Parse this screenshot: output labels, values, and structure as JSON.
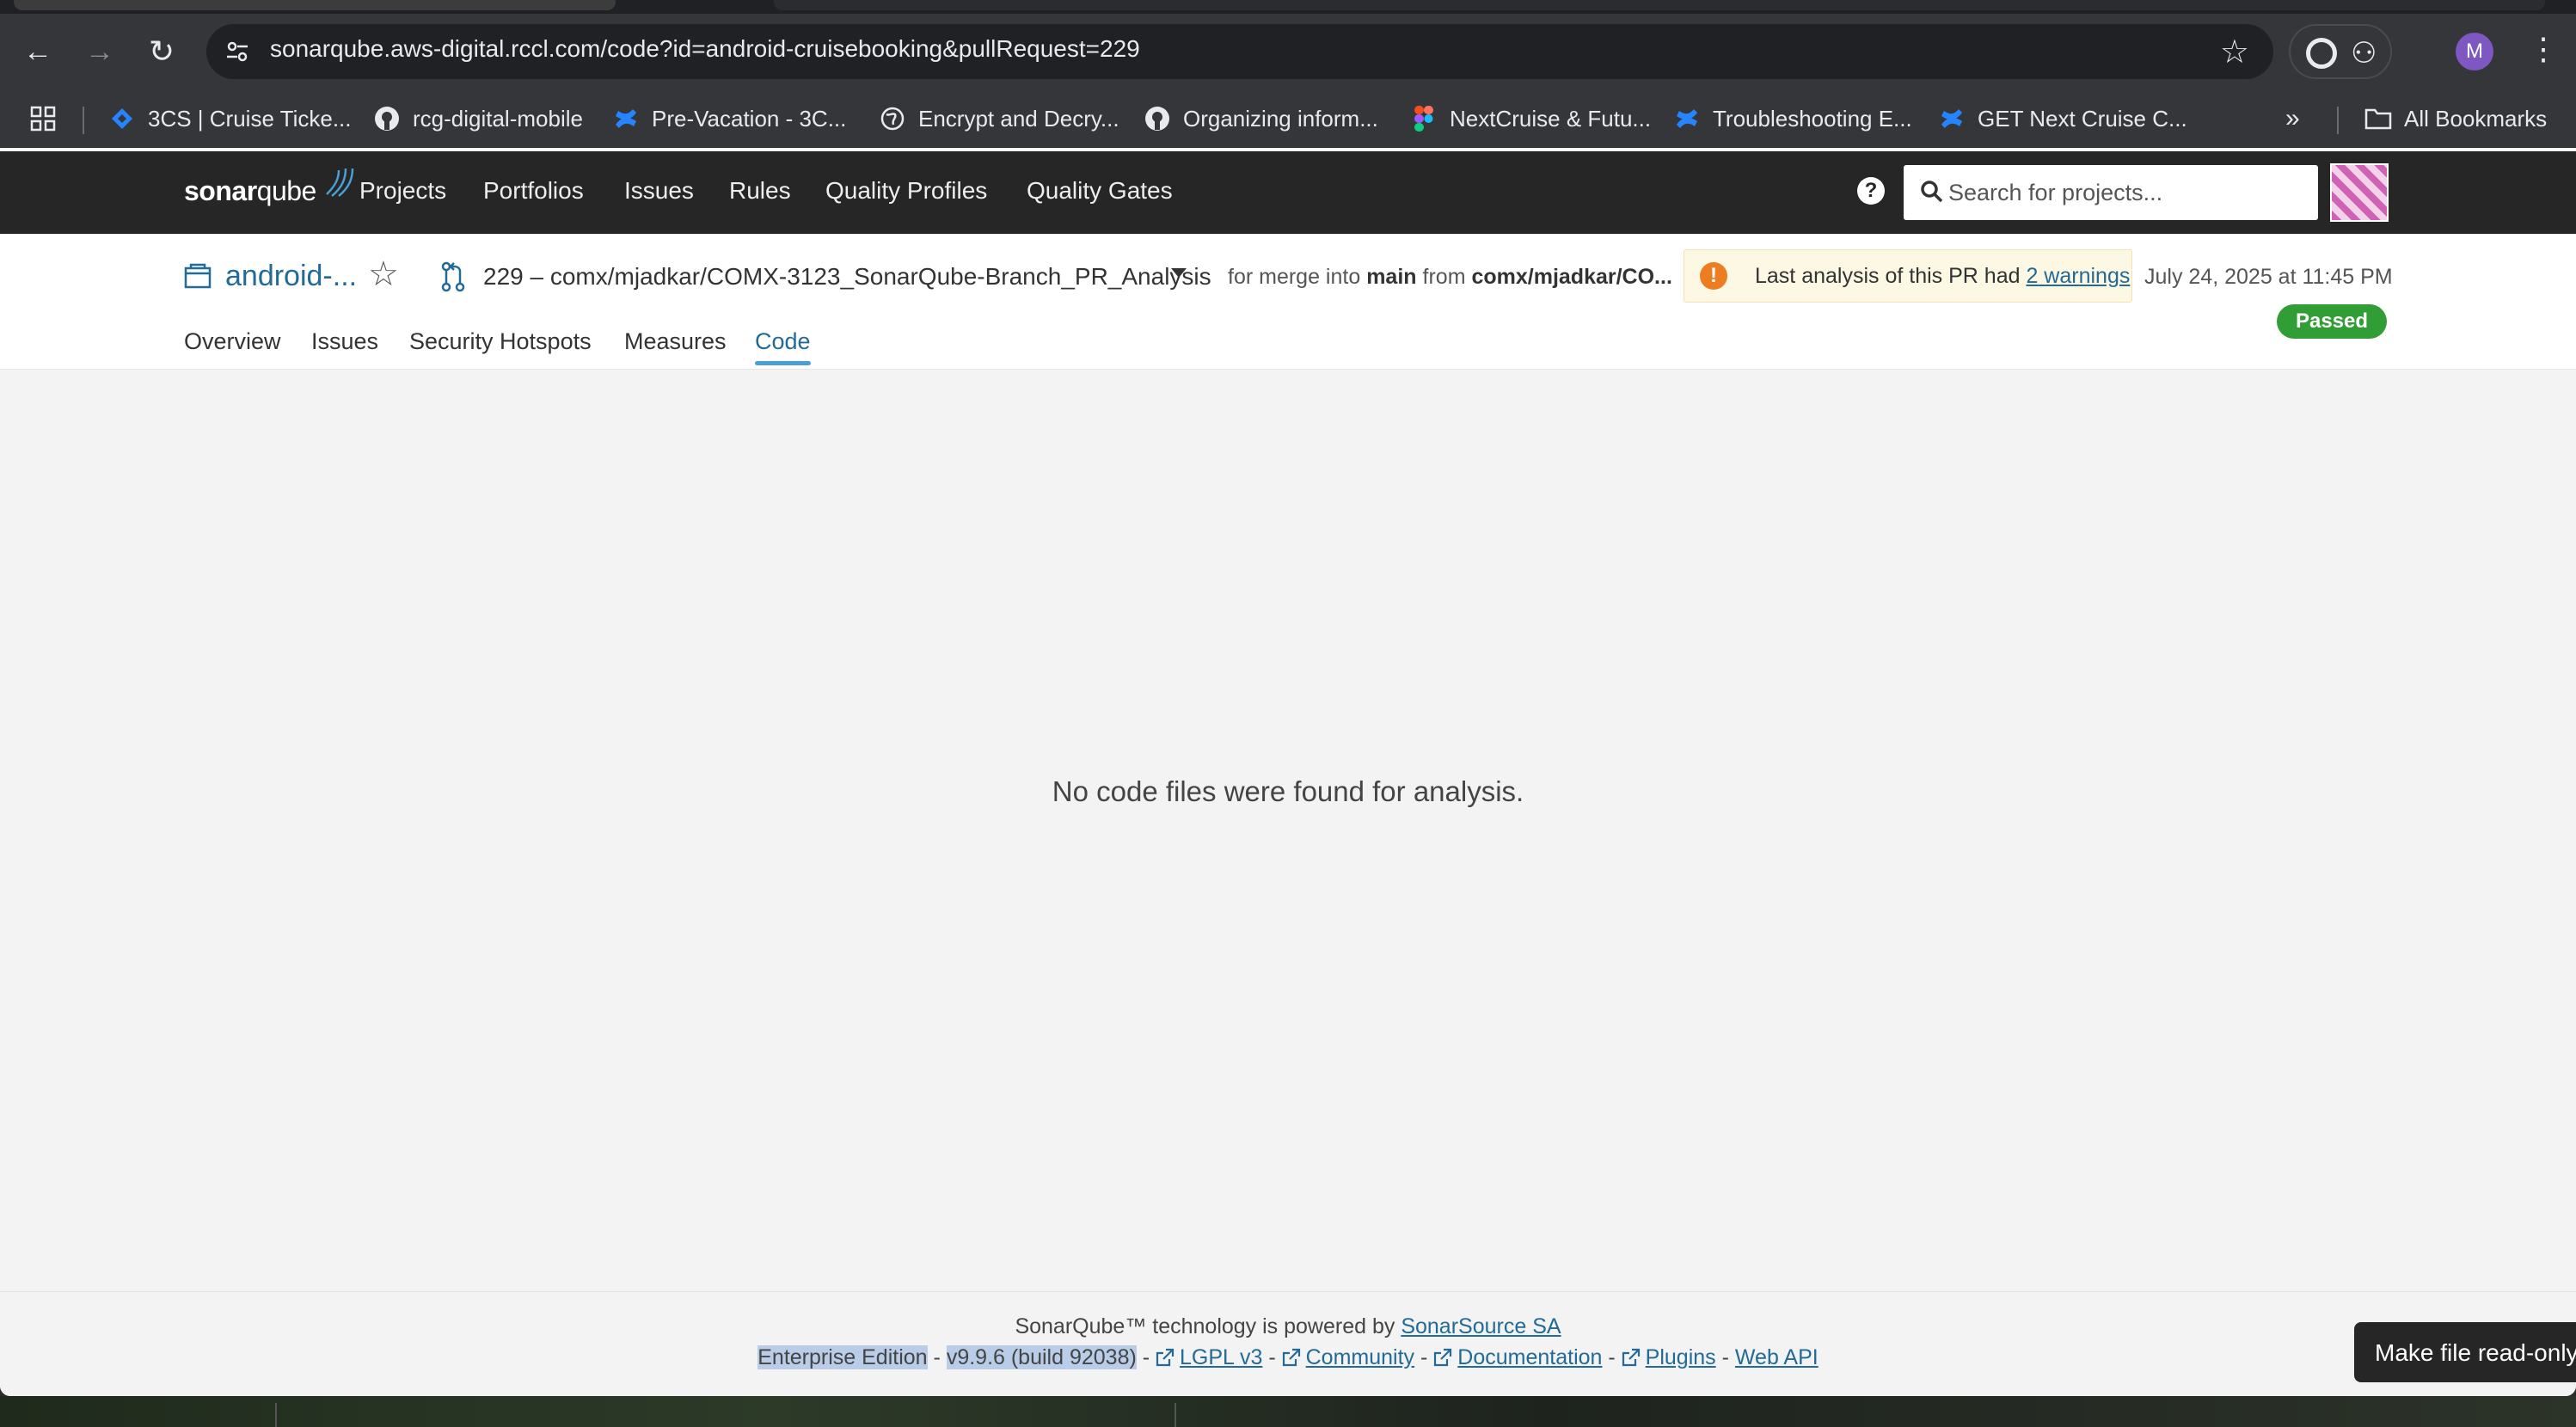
{
  "browser": {
    "url_domain": "sonarqube.aws-digital.rccl.com",
    "url_path": "/code?id=android-cruisebooking&pullRequest=229",
    "profile_initial": "M",
    "bookmarks": [
      {
        "label": "3CS | Cruise Ticke...",
        "icon": "jira-icon"
      },
      {
        "label": "rcg-digital-mobile",
        "icon": "github-icon"
      },
      {
        "label": "Pre-Vacation - 3C...",
        "icon": "confluence-icon"
      },
      {
        "label": "Encrypt and Decry...",
        "icon": "globe-icon"
      },
      {
        "label": "Organizing inform...",
        "icon": "github-icon"
      },
      {
        "label": "NextCruise & Futu...",
        "icon": "figma-icon"
      },
      {
        "label": "Troubleshooting E...",
        "icon": "confluence-icon"
      },
      {
        "label": "GET Next Cruise C...",
        "icon": "confluence-icon"
      }
    ],
    "all_bookmarks": "All Bookmarks"
  },
  "sonar_nav": {
    "logo_bold": "sonar",
    "logo_light": "qube",
    "links": [
      "Projects",
      "Portfolios",
      "Issues",
      "Rules",
      "Quality Profiles",
      "Quality Gates"
    ],
    "search_placeholder": "Search for projects..."
  },
  "project": {
    "name": "android-...",
    "pr_label": "229 – comx/mjadkar/COMX-3123_SonarQube-Branch_PR_Analysis",
    "merge_prefix": "for merge into",
    "merge_target": "main",
    "merge_from": "from",
    "merge_source": "comx/mjadkar/CO...",
    "warning_text": "Last analysis of this PR had",
    "warning_link": "2 warnings",
    "analysis_date": "July 24, 2025 at 11:45 PM",
    "status": "Passed",
    "tabs": [
      "Overview",
      "Issues",
      "Security Hotspots",
      "Measures",
      "Code"
    ],
    "active_tab": "Code"
  },
  "main": {
    "empty_message": "No code files were found for analysis."
  },
  "footer": {
    "line1_text": "SonarQube™ technology is powered by",
    "line1_link": "SonarSource SA",
    "edition": "Enterprise Edition",
    "version": "v9.9.6 (build 92038)",
    "links": [
      "LGPL v3",
      "Community",
      "Documentation",
      "Plugins"
    ],
    "web_api": "Web API"
  },
  "toast": "Make file read-only"
}
